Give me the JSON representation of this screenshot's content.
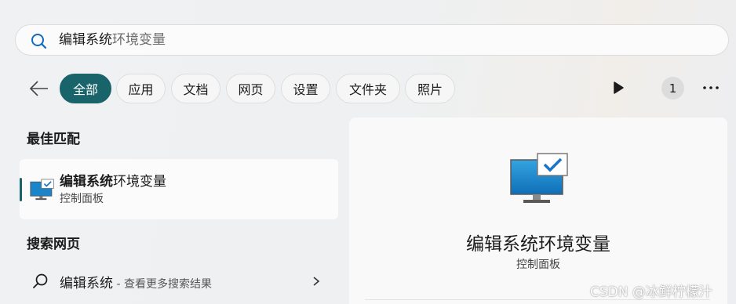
{
  "search": {
    "typed": "编辑系统",
    "completion": "环境变量",
    "icon": "search-icon"
  },
  "filters": {
    "back_icon": "back-arrow-icon",
    "chips": [
      "全部",
      "应用",
      "文档",
      "网页",
      "设置",
      "文件夹",
      "照片"
    ],
    "active": "全部",
    "play_icon": "play-icon",
    "badge_count": "1",
    "more_icon": "more-icon"
  },
  "best_match": {
    "section_title": "最佳匹配",
    "name_bold": "编辑系统",
    "name_rest": "环境变量",
    "subtitle": "控制面板",
    "icon": "control-panel-monitor-icon"
  },
  "web": {
    "section_title": "搜索网页",
    "query": "编辑系统",
    "hint": " - 查看更多搜索结果",
    "icon": "search-icon",
    "chevron": "chevron-right-icon"
  },
  "preview": {
    "title": "编辑系统环境变量",
    "subtitle": "控制面板",
    "icon": "control-panel-monitor-icon"
  },
  "watermark": "CSDN @冰鲜柠檬汁",
  "colors": {
    "accent": "#19636b",
    "search_icon": "#0f6cbd"
  }
}
